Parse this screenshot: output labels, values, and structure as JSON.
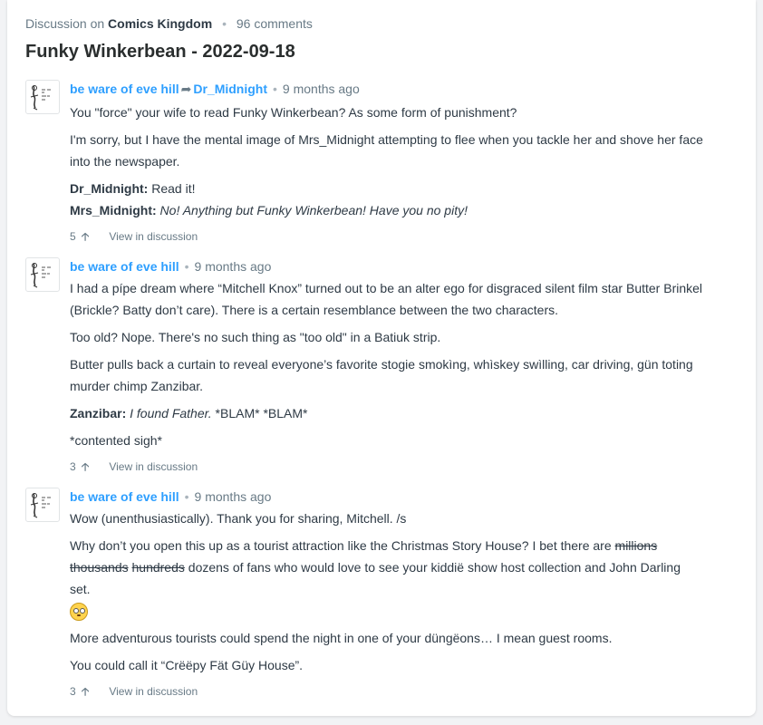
{
  "header": {
    "prefix": "Discussion on",
    "site": "Comics Kingdom",
    "separator": "•",
    "comment_count": "96 comments"
  },
  "title": "Funky Winkerbean - 2022-09-18",
  "icons": {
    "upvote": "arrow-up-icon",
    "reply": "reply-arrow-icon",
    "emoji": "rolling-eyes-emoji-icon"
  },
  "comments": [
    {
      "author": "be ware of eve hill",
      "reply_to": "Dr_Midnight",
      "time": "9 months ago",
      "p1": "You \"force\" your wife to read Funky Winkerbean? As some form of punishment?",
      "p2": "I'm sorry, but I have the mental image of Mrs_Midnight attempting to flee when you tackle her and shove her face into the newspaper.",
      "p3_speaker": "Dr_Midnight:",
      "p3_text": "Read it!",
      "p4_speaker": "Mrs_Midnight:",
      "p4_text": "No! Anything but Funky Winkerbean! Have you no pity!",
      "votes": "5",
      "view": "View in discussion"
    },
    {
      "author": "be ware of eve hill",
      "time": "9 months ago",
      "p1": "I had a pípe dream where “Mitchell Knox” turned out to be an alter ego for disgraced silent film star Butter Brinkel (Brickle? Batty don’t care). There is a certain resemblance between the two characters.",
      "p2": "Too old? Nope. There's no such thing as \"too old\" in a Batiuk strip.",
      "p3": "Butter pulls back a curtain to reveal everyone’s favorite stogie smokìng, whìskey swìlling, car driving, gün toting murder chimp Zanzibar.",
      "p4_speaker": "Zanzibar:",
      "p4_italic": "I found Father.",
      "p4_rest": " *BLAM* *BLAM*",
      "p5": "*contented sigh*",
      "votes": "3",
      "view": "View in discussion"
    },
    {
      "author": "be ware of eve hill",
      "time": "9 months ago",
      "p1": "Wow (unenthusiastically). Thank you for sharing, Mitchell. /s",
      "p2_a": "Why don’t you open this up as a tourist attraction like the Christmas Story House? I bet there are ",
      "p2_s1": "millions",
      "p2_s2": "thousands",
      "p2_s3": "hundreds",
      "p2_b": " dozens of fans who would love to see your kiddië show host collection and John Darling set.",
      "p4": "More adventurous tourists could spend the night in one of your düngëons… I mean guest rooms.",
      "p5": "You could call it “Crëëpy Fät Güy House”.",
      "votes": "3",
      "view": "View in discussion"
    }
  ]
}
